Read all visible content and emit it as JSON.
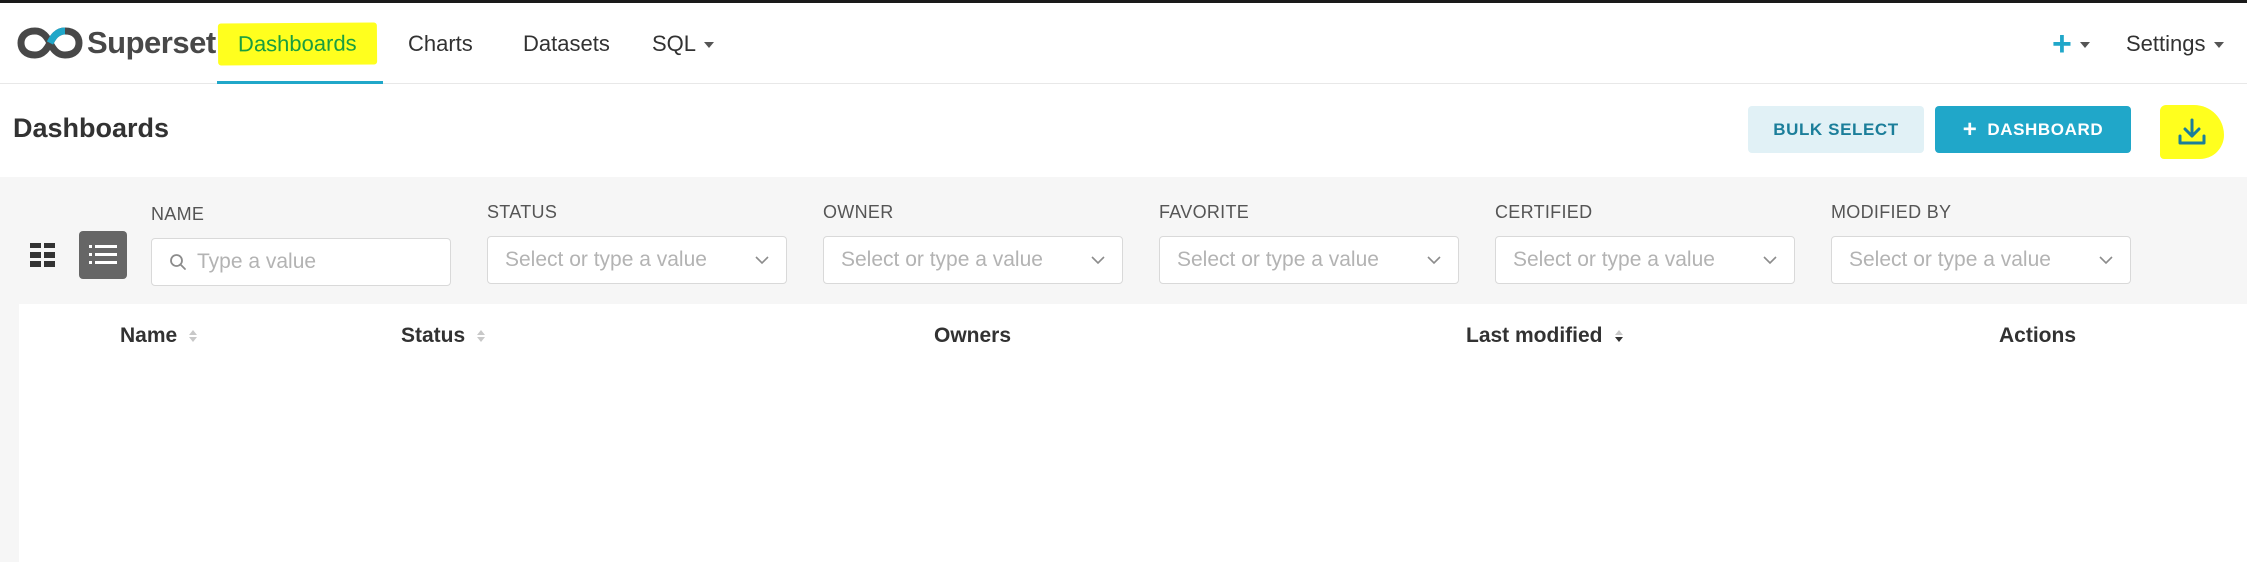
{
  "app": {
    "brand": "Superset"
  },
  "nav": {
    "items": [
      {
        "label": "Dashboards",
        "active": true
      },
      {
        "label": "Charts"
      },
      {
        "label": "Datasets"
      },
      {
        "label": "SQL"
      }
    ],
    "right": {
      "add_label": "+",
      "settings_label": "Settings"
    }
  },
  "header": {
    "title": "Dashboards",
    "bulk_select_label": "BULK SELECT",
    "add_dashboard_label": "DASHBOARD",
    "download_icon": "download-icon"
  },
  "filters": [
    {
      "label": "NAME",
      "placeholder": "Type a value",
      "type": "search"
    },
    {
      "label": "STATUS",
      "placeholder": "Select or type a value",
      "type": "select"
    },
    {
      "label": "OWNER",
      "placeholder": "Select or type a value",
      "type": "select"
    },
    {
      "label": "FAVORITE",
      "placeholder": "Select or type a value",
      "type": "select"
    },
    {
      "label": "CERTIFIED",
      "placeholder": "Select or type a value",
      "type": "select"
    },
    {
      "label": "MODIFIED BY",
      "placeholder": "Select or type a value",
      "type": "select"
    }
  ],
  "table": {
    "columns": [
      {
        "label": "Name",
        "sortable": true,
        "sort": "none"
      },
      {
        "label": "Status",
        "sortable": true,
        "sort": "none"
      },
      {
        "label": "Owners",
        "sortable": false
      },
      {
        "label": "Last modified",
        "sortable": true,
        "sort": "desc"
      },
      {
        "label": "Actions",
        "sortable": false
      }
    ],
    "rows": []
  },
  "colors": {
    "primary": "#20a7c9",
    "highlight": "#ffff1e",
    "bulk_bg": "#e1f1f6"
  }
}
